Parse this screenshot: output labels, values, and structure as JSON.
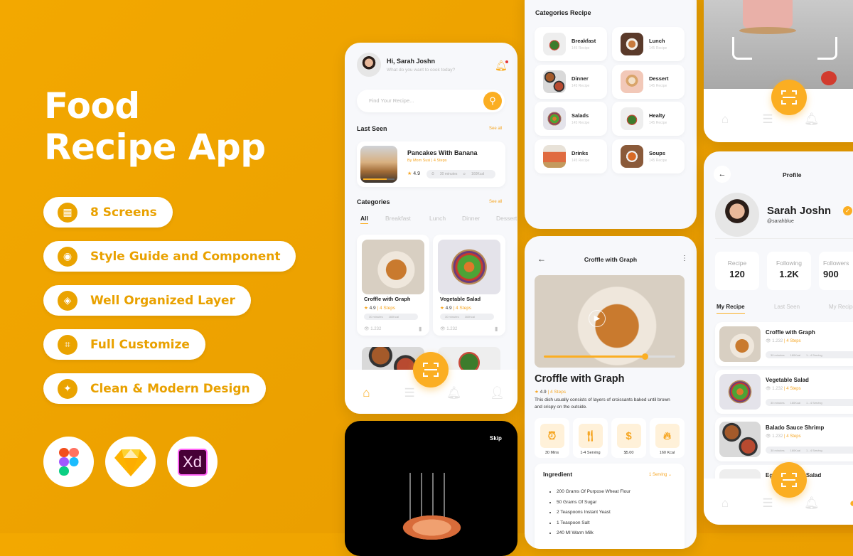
{
  "hero": {
    "line1": "Food",
    "line2": "Recipe App"
  },
  "features": [
    {
      "icon": "grid-icon",
      "label": "8 Screens"
    },
    {
      "icon": "palette-icon",
      "label": "Style Guide and Component"
    },
    {
      "icon": "layers-icon",
      "label": "Well Organized Layer"
    },
    {
      "icon": "crop-icon",
      "label": "Full Customize"
    },
    {
      "icon": "sparkle-icon",
      "label": "Clean & Modern Design"
    }
  ],
  "tools": [
    {
      "name": "Figma"
    },
    {
      "name": "Sketch"
    },
    {
      "name": "Xd"
    }
  ],
  "colors": {
    "background": "#eca100",
    "accent": "#fbae22",
    "text": "#222222"
  },
  "home": {
    "greeting": "Hi, Sarah Joshn",
    "subtitle": "What do you want to cook today?",
    "search_placeholder": "Find Your Recipe...",
    "last_seen_title": "Last Seen",
    "see_all": "See all",
    "last_seen": {
      "title": "Pancakes With Banana",
      "by": "By Mom Susi | 4 Steps",
      "rating": "4.9",
      "time": "30 minutes",
      "kcal": "160Kcal"
    },
    "categories_title": "Categories",
    "tabs": [
      "All",
      "Breakfast",
      "Lunch",
      "Dinner",
      "Dessert"
    ],
    "cards": [
      {
        "title": "Croffle with Graph",
        "rating": "4.9",
        "steps": "4 Steps",
        "time": "30 minutes",
        "kcal": "160Kcal",
        "views": "1.232"
      },
      {
        "title": "Vegetable Salad",
        "rating": "4.9",
        "steps": "4 Steps",
        "time": "30 minutes",
        "kcal": "160Kcal",
        "views": "1.232"
      }
    ]
  },
  "onboarding": {
    "skip": "Skip"
  },
  "categories_screen": {
    "title": "Categories Recipe",
    "items": [
      {
        "name": "Breakfast",
        "count": "145 Recipe"
      },
      {
        "name": "Lunch",
        "count": "145 Recipe"
      },
      {
        "name": "Dinner",
        "count": "145 Recipe"
      },
      {
        "name": "Dessert",
        "count": "145 Recipe"
      },
      {
        "name": "Salads",
        "count": "145 Recipe"
      },
      {
        "name": "Healty",
        "count": "145 Recipe"
      },
      {
        "name": "Drinks",
        "count": "145 Recipe"
      },
      {
        "name": "Soups",
        "count": "145 Recipe"
      }
    ]
  },
  "detail": {
    "header": "Croffle with Graph",
    "title": "Croffle with Graph",
    "rating": "4.9",
    "steps": "4 Steps",
    "description": "This dish usually consists of layers of croissants baked until brown and crispy on the outside.",
    "video_progress": 0.77,
    "stats": [
      {
        "icon": "alarm-clock-icon",
        "label": "30 Mins"
      },
      {
        "icon": "fork-knife-icon",
        "label": "1-4 Serving"
      },
      {
        "icon": "dollar-icon",
        "label": "$5.00"
      },
      {
        "icon": "fire-icon",
        "label": "160 Kcal"
      }
    ],
    "ingredient_title": "Ingredient",
    "serving_select": "1 Serving",
    "ingredients": [
      "200 Grams Of Purpose Wheat Flour",
      "50 Grams Of Sugar",
      "2 Teaspoons Instant Yeast",
      "1 Teaspoon Salt",
      "240 Ml Warm Milk"
    ]
  },
  "profile": {
    "header": "Profile",
    "name": "Sarah Joshn",
    "handle": "@sarahblue",
    "stats": [
      {
        "label": "Recipe",
        "value": "120"
      },
      {
        "label": "Following",
        "value": "1.2K"
      },
      {
        "label": "Followers",
        "value": "900"
      }
    ],
    "tabs": [
      "My Recipe",
      "Last Seen",
      "My Recipe"
    ],
    "recipes": [
      {
        "title": "Croffle with Graph",
        "views": "1.232",
        "steps": "4 Steps",
        "time": "30 minutes",
        "kcal": "160Kcal",
        "serving": "1 - 4 Serving"
      },
      {
        "title": "Vegetable Salad",
        "views": "1.232",
        "steps": "4 Steps",
        "time": "30 minutes",
        "kcal": "160Kcal",
        "serving": "1 - 4 Serving"
      },
      {
        "title": "Balado Sauce Shrimp",
        "views": "1.232",
        "steps": "4 Steps",
        "time": "30 minutes",
        "kcal": "160Kcal",
        "serving": "1 - 4 Serving"
      },
      {
        "title": "Egg Vegetable Salad"
      }
    ]
  }
}
